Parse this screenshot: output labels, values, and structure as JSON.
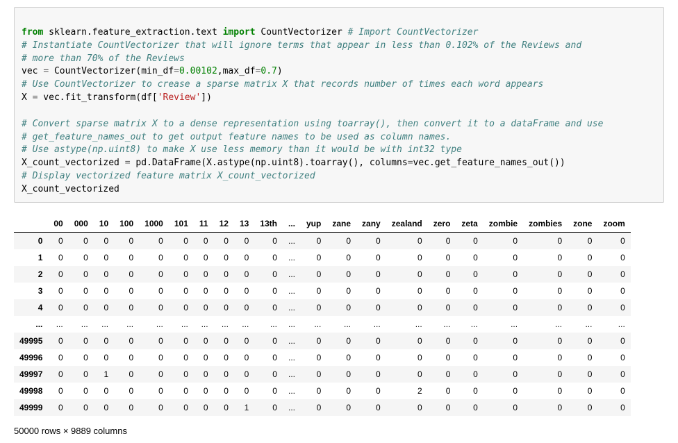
{
  "code": {
    "l1_from": "from",
    "l1_mod1": " sklearn.feature_extraction.text ",
    "l1_import": "import",
    "l1_mod2": " CountVectorizer ",
    "l1_cm": "# Import CountVectorizer",
    "l2_cm": "# Instantiate CountVectorizer that will ignore terms that appear in less than 0.102% of the Reviews and",
    "l3_cm": "# more than 70% of the Reviews",
    "l4_a": "vec ",
    "l4_eq": "=",
    "l4_b": " CountVectorizer(min_df",
    "l4_eq2": "=",
    "l4_v1": "0.00102",
    "l4_c": ",max_df",
    "l4_eq3": "=",
    "l4_v2": "0.7",
    "l4_d": ")",
    "l5_cm": "# Use CountVectorizer to crease a sparse matrix X that records number of times each word appears",
    "l6_a": "X ",
    "l6_eq": "=",
    "l6_b": " vec.fit_transform(df[",
    "l6_str": "'Review'",
    "l6_c": "])",
    "l8_cm": "# Convert sparse matrix X to a dense representation using toarray(), then convert it to a dataFrame and use",
    "l9_cm": "# get_feature_names_out to get output feature names to be used as column names.",
    "l10_cm": "# Use astype(np.uint8) to make X use less memory than it would be with int32 type",
    "l11_a": "X_count_vectorized ",
    "l11_eq": "=",
    "l11_b": " pd.DataFrame(X.astype(np.uint8).toarray(), columns",
    "l11_eq2": "=",
    "l11_c": "vec.get_feature_names_out())",
    "l12_cm": "# Display vectorized feature matrix X_count_vectorized",
    "l13": "X_count_vectorized"
  },
  "table": {
    "columns": [
      "00",
      "000",
      "10",
      "100",
      "1000",
      "101",
      "11",
      "12",
      "13",
      "13th",
      "...",
      "yup",
      "zane",
      "zany",
      "zealand",
      "zero",
      "zeta",
      "zombie",
      "zombies",
      "zone",
      "zoom"
    ],
    "index": [
      "0",
      "1",
      "2",
      "3",
      "4",
      "...",
      "49995",
      "49996",
      "49997",
      "49998",
      "49999"
    ],
    "rows": [
      [
        "0",
        "0",
        "0",
        "0",
        "0",
        "0",
        "0",
        "0",
        "0",
        "0",
        "...",
        "0",
        "0",
        "0",
        "0",
        "0",
        "0",
        "0",
        "0",
        "0",
        "0"
      ],
      [
        "0",
        "0",
        "0",
        "0",
        "0",
        "0",
        "0",
        "0",
        "0",
        "0",
        "...",
        "0",
        "0",
        "0",
        "0",
        "0",
        "0",
        "0",
        "0",
        "0",
        "0"
      ],
      [
        "0",
        "0",
        "0",
        "0",
        "0",
        "0",
        "0",
        "0",
        "0",
        "0",
        "...",
        "0",
        "0",
        "0",
        "0",
        "0",
        "0",
        "0",
        "0",
        "0",
        "0"
      ],
      [
        "0",
        "0",
        "0",
        "0",
        "0",
        "0",
        "0",
        "0",
        "0",
        "0",
        "...",
        "0",
        "0",
        "0",
        "0",
        "0",
        "0",
        "0",
        "0",
        "0",
        "0"
      ],
      [
        "0",
        "0",
        "0",
        "0",
        "0",
        "0",
        "0",
        "0",
        "0",
        "0",
        "...",
        "0",
        "0",
        "0",
        "0",
        "0",
        "0",
        "0",
        "0",
        "0",
        "0"
      ],
      [
        "...",
        "...",
        "...",
        "...",
        "...",
        "...",
        "...",
        "...",
        "...",
        "...",
        "...",
        "...",
        "...",
        "...",
        "...",
        "...",
        "...",
        "...",
        "...",
        "...",
        "..."
      ],
      [
        "0",
        "0",
        "0",
        "0",
        "0",
        "0",
        "0",
        "0",
        "0",
        "0",
        "...",
        "0",
        "0",
        "0",
        "0",
        "0",
        "0",
        "0",
        "0",
        "0",
        "0"
      ],
      [
        "0",
        "0",
        "0",
        "0",
        "0",
        "0",
        "0",
        "0",
        "0",
        "0",
        "...",
        "0",
        "0",
        "0",
        "0",
        "0",
        "0",
        "0",
        "0",
        "0",
        "0"
      ],
      [
        "0",
        "0",
        "1",
        "0",
        "0",
        "0",
        "0",
        "0",
        "0",
        "0",
        "...",
        "0",
        "0",
        "0",
        "0",
        "0",
        "0",
        "0",
        "0",
        "0",
        "0"
      ],
      [
        "0",
        "0",
        "0",
        "0",
        "0",
        "0",
        "0",
        "0",
        "0",
        "0",
        "...",
        "0",
        "0",
        "0",
        "2",
        "0",
        "0",
        "0",
        "0",
        "0",
        "0"
      ],
      [
        "0",
        "0",
        "0",
        "0",
        "0",
        "0",
        "0",
        "0",
        "1",
        "0",
        "...",
        "0",
        "0",
        "0",
        "0",
        "0",
        "0",
        "0",
        "0",
        "0",
        "0"
      ]
    ],
    "shape_text": "50000 rows × 9889 columns"
  }
}
